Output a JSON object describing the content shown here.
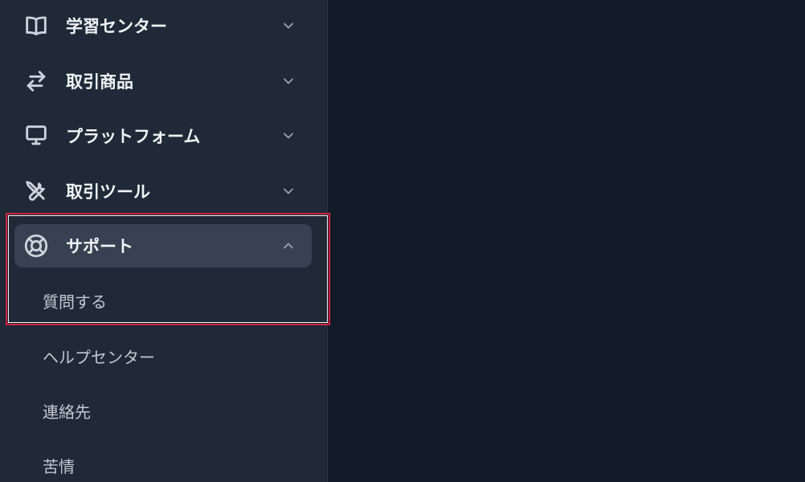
{
  "sidebar": {
    "items": [
      {
        "label": "学習センター",
        "icon": "book-open-icon",
        "state": "collapsed"
      },
      {
        "label": "取引商品",
        "icon": "arrows-exchange-icon",
        "state": "collapsed"
      },
      {
        "label": "プラットフォーム",
        "icon": "desktop-monitor-icon",
        "state": "collapsed"
      },
      {
        "label": "取引ツール",
        "icon": "wrench-screwdriver-icon",
        "state": "collapsed"
      },
      {
        "label": "サポート",
        "icon": "lifebuoy-icon",
        "state": "expanded"
      }
    ],
    "support_subitems": [
      {
        "label": "質問する"
      },
      {
        "label": "ヘルプセンター"
      },
      {
        "label": "連絡先"
      },
      {
        "label": "苦情"
      }
    ]
  },
  "colors": {
    "sidebar_bg": "#1f2937",
    "main_bg": "#131a27",
    "expanded_item_bg": "#374151",
    "highlight_border": "#d0243c"
  }
}
